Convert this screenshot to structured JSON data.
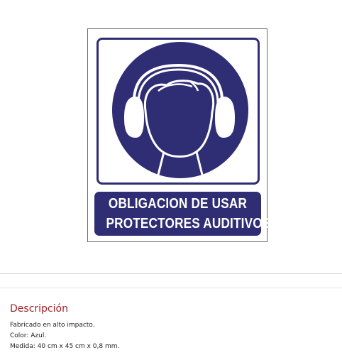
{
  "sign": {
    "line1": "OBLIGACION DE USAR",
    "line2": "PROTECTORES AUDITIVOS",
    "icon": "ear-protection-icon",
    "color": "#2f2d74"
  },
  "description": {
    "title": "Descripción",
    "lines": [
      "Fabricado en alto impacto.",
      "Color: Azul.",
      "Medida: 40 cm x 45 cm x 0,8 mm."
    ]
  }
}
